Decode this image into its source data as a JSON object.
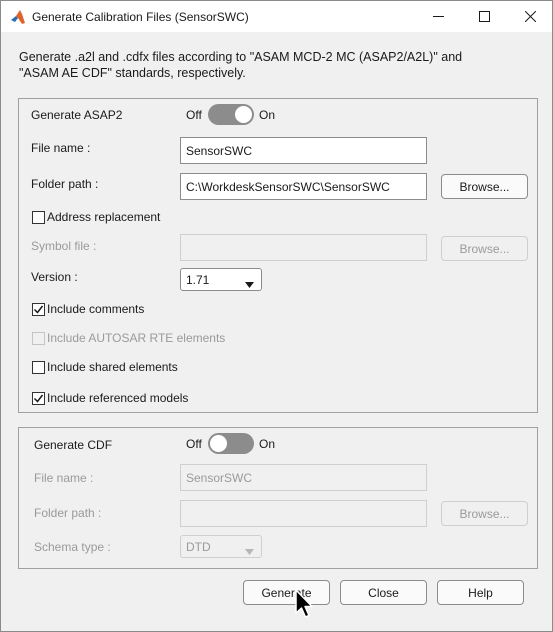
{
  "window": {
    "title": "Generate Calibration Files (SensorSWC)",
    "controls": {
      "minimize": "minimize-icon",
      "maximize": "maximize-icon",
      "close": "close-icon"
    }
  },
  "intro": {
    "line1": "Generate .a2l and .cdfx files according to \"ASAM MCD-2 MC (ASAP2/A2L)\" and",
    "line2": "\"ASAM AE CDF\" standards, respectively."
  },
  "asap2": {
    "heading": "Generate ASAP2",
    "toggle_off": "Off",
    "toggle_on": "On",
    "toggle_state": "on",
    "file_name_label": "File name :",
    "file_name_value": "SensorSWC",
    "folder_path_label": "Folder path :",
    "folder_path_value": "C:\\WorkdeskSensorSWC\\SensorSWC",
    "browse_label": "Browse...",
    "address_replacement_label": "Address replacement",
    "address_replacement_checked": false,
    "symbol_file_label": "Symbol file :",
    "symbol_file_value": "",
    "symbol_browse_label": "Browse...",
    "version_label": "Version :",
    "version_value": "1.71",
    "include_comments_label": "Include comments",
    "include_comments_checked": true,
    "include_autosar_label": "Include AUTOSAR RTE elements",
    "include_autosar_checked": false,
    "include_shared_label": "Include shared elements",
    "include_shared_checked": false,
    "include_referenced_label": "Include referenced models",
    "include_referenced_checked": true
  },
  "cdf": {
    "heading": "Generate CDF",
    "toggle_off": "Off",
    "toggle_on": "On",
    "toggle_state": "off",
    "file_name_label": "File name :",
    "file_name_value": "SensorSWC",
    "folder_path_label": "Folder path :",
    "folder_path_value": "",
    "browse_label": "Browse...",
    "schema_type_label": "Schema type :",
    "schema_type_value": "DTD"
  },
  "footer": {
    "generate_label": "Generate",
    "close_label": "Close",
    "help_label": "Help"
  },
  "colors": {
    "window_bg": "#f0f0f0",
    "titlebar_bg": "#ffffff",
    "toggle_track": "#8c8c8c",
    "disabled_text": "#9a9a9a"
  }
}
